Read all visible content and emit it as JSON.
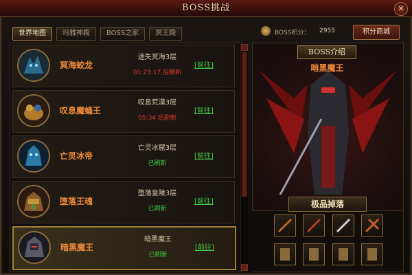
{
  "window": {
    "title": "BOSS挑战",
    "close_label": "✕"
  },
  "tabs": [
    {
      "label": "世界地图",
      "active": true
    },
    {
      "label": "玛雅神殿",
      "active": false
    },
    {
      "label": "BOSS之家",
      "active": false
    },
    {
      "label": "冥王殿",
      "active": false
    }
  ],
  "points": {
    "label": "BOSS积分：",
    "value": "2955",
    "shop_label": "积分商城"
  },
  "boss_list": [
    {
      "name": "冥海蛟龙",
      "location": "迷失冥海3层",
      "timer": "01:23:17 后刷新",
      "status": "cooldown",
      "action": "[前往]",
      "portrait_color": "#2a6a8a"
    },
    {
      "name": "叹息魔蛹王",
      "location": "叹息荒漠3层",
      "timer": "05:34 后刷新",
      "status": "cooldown",
      "action": "[前往]",
      "portrait_color": "#b07a2a"
    },
    {
      "name": "亡灵冰帝",
      "location": "亡灵冰窟3层",
      "timer": "已刷新",
      "status": "ready",
      "action": "[前往]",
      "portrait_color": "#2a7aa8"
    },
    {
      "name": "堕落王魂",
      "location": "堕落皇陵3层",
      "timer": "已刷新",
      "status": "ready",
      "action": "[前往]",
      "portrait_color": "#8a5a2a"
    },
    {
      "name": "暗黑魔王",
      "location": "暗黑魔王",
      "timer": "已刷新",
      "status": "ready",
      "action": "[前往]",
      "portrait_color": "#5a5a6a"
    }
  ],
  "intro": {
    "title": "BOSS介绍",
    "boss_name": "暗黑魔王"
  },
  "drops": {
    "title": "极品掉落",
    "item_count": 8
  },
  "colors": {
    "accent": "#f08a3a",
    "ready": "#3ec63e",
    "cooldown": "#e23a2a",
    "border": "#a0824e"
  }
}
